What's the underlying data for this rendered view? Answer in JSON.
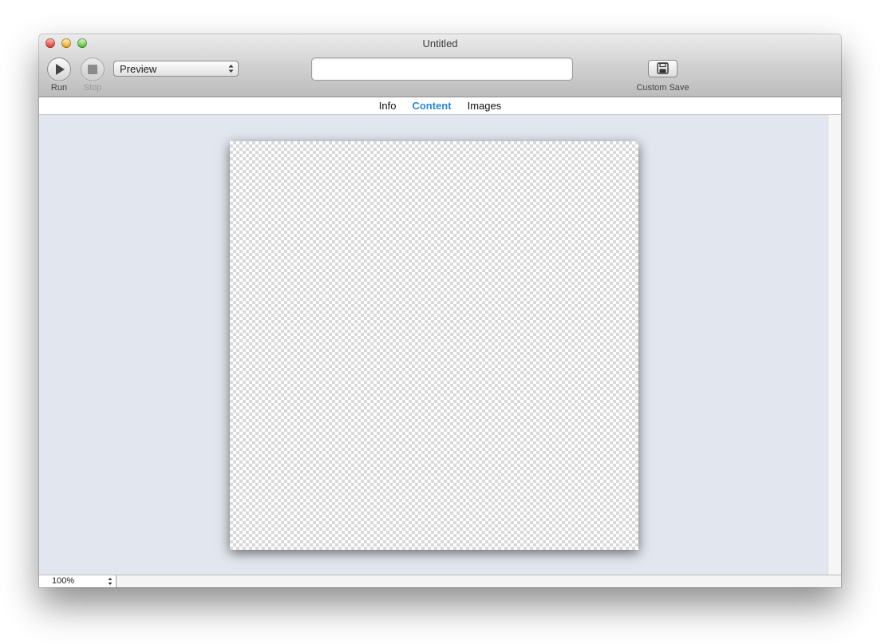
{
  "window": {
    "title": "Untitled"
  },
  "toolbar": {
    "run_label": "Run",
    "stop_label": "Stop",
    "mode_popup_value": "Preview",
    "address_value": "",
    "address_placeholder": "",
    "custom_save_label": "Custom Save"
  },
  "tabs": [
    {
      "label": "Info",
      "active": false
    },
    {
      "label": "Content",
      "active": true
    },
    {
      "label": "Images",
      "active": false
    }
  ],
  "status": {
    "zoom_value": "100%"
  },
  "colors": {
    "active_tab": "#2a8ad4",
    "content_background": "#e2e6ee",
    "checker_dark": "#d9d9d9",
    "checker_light": "#ffffff"
  },
  "icons": {
    "run": "play-icon",
    "stop": "stop-icon",
    "save": "floppy-disk-icon",
    "popup": "up-down-arrows-icon"
  }
}
